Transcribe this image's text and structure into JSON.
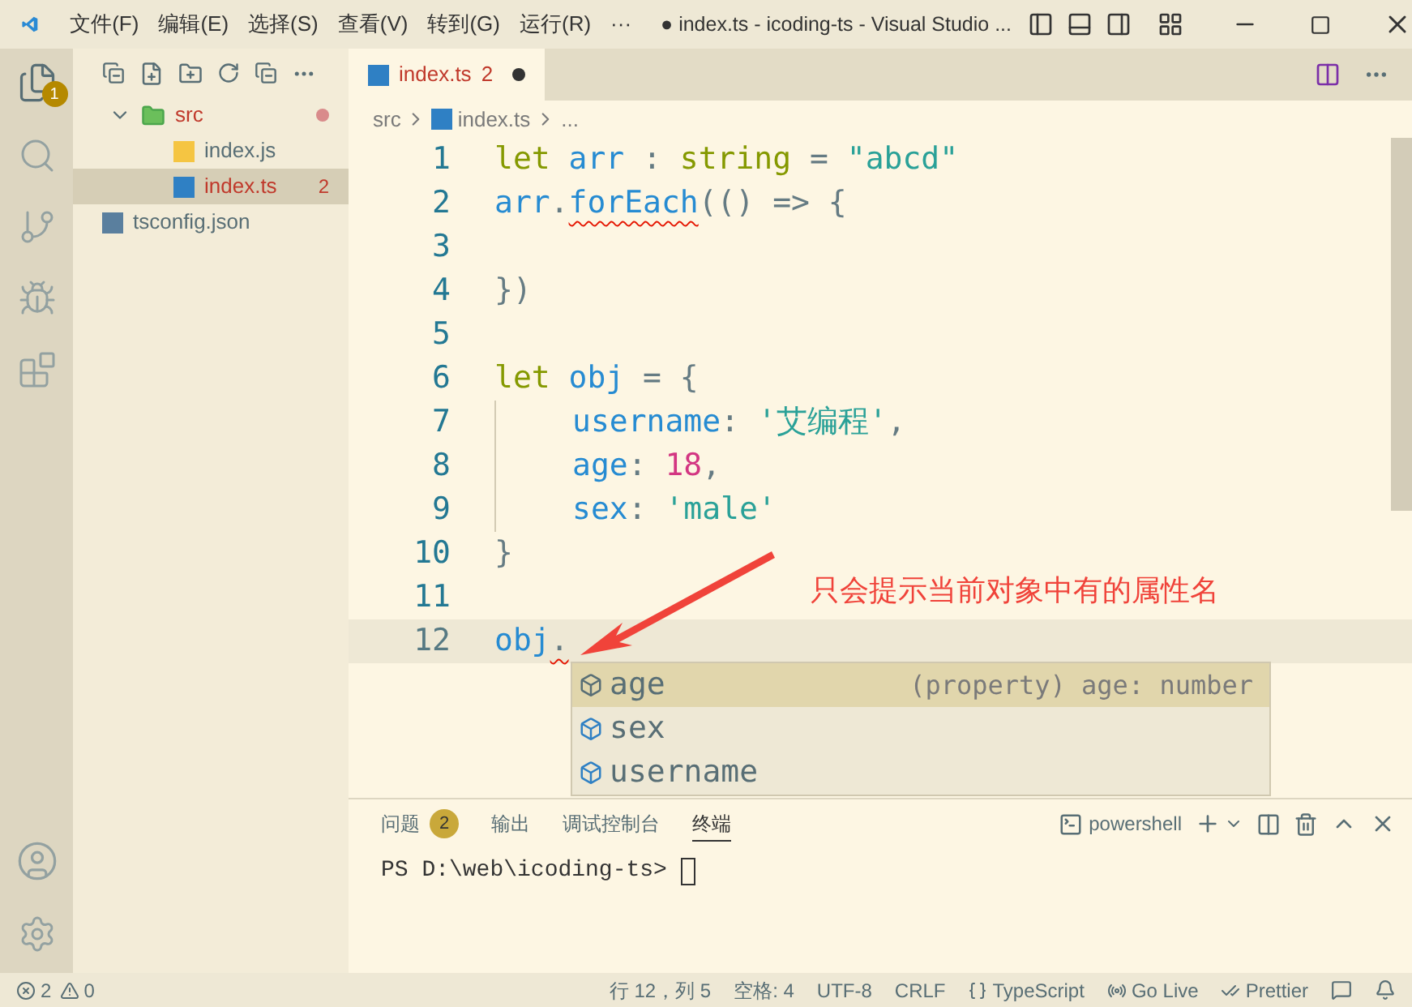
{
  "title_bar": {
    "menus": [
      "文件(F)",
      "编辑(E)",
      "选择(S)",
      "查看(V)",
      "转到(G)",
      "运行(R)",
      "···"
    ],
    "title": "● index.ts - icoding-ts - Visual Studio ..."
  },
  "activity_bar": {
    "explorer_badge": "1"
  },
  "explorer": {
    "items": [
      {
        "name": "src",
        "kind": "folder",
        "expanded": true,
        "modified": true,
        "selected": false,
        "children": [
          {
            "name": "index.js",
            "kind": "js",
            "selected": false
          },
          {
            "name": "index.ts",
            "kind": "ts",
            "selected": true,
            "errors": "2"
          }
        ]
      },
      {
        "name": "tsconfig.json",
        "kind": "tsconfig",
        "selected": false
      }
    ]
  },
  "tabs": [
    {
      "label": "index.ts",
      "errors": "2",
      "dirty": true,
      "selected": true
    }
  ],
  "breadcrumb": [
    "src",
    "index.ts",
    "..."
  ],
  "code_lines": [
    {
      "number": "1",
      "current": false,
      "tokens": [
        {
          "text": "let",
          "kind": "keyword"
        },
        {
          "text": " arr",
          "kind": "name"
        },
        {
          "text": " : ",
          "kind": "plain"
        },
        {
          "text": "string",
          "kind": "keyword"
        },
        {
          "text": " = ",
          "kind": "plain"
        },
        {
          "text": "\"abcd\"",
          "kind": "string"
        }
      ]
    },
    {
      "number": "2",
      "current": false,
      "tokens": [
        {
          "text": "arr",
          "kind": "name",
          "error": false
        },
        {
          "text": ".",
          "kind": "plain",
          "error": false
        },
        {
          "text": "forEach",
          "kind": "name",
          "error": true
        },
        {
          "text": "(() => {",
          "kind": "plain",
          "error": false
        }
      ]
    },
    {
      "number": "3",
      "current": false
    },
    {
      "number": "4",
      "current": false,
      "tokens": [
        {
          "text": "})",
          "kind": "plain"
        }
      ]
    },
    {
      "number": "5",
      "current": false
    },
    {
      "number": "6",
      "current": false,
      "tokens": [
        {
          "text": "let",
          "kind": "keyword"
        },
        {
          "text": " obj",
          "kind": "name"
        },
        {
          "text": " = {",
          "kind": "plain"
        }
      ]
    },
    {
      "number": "7",
      "current": false,
      "indent": true,
      "tokens": [
        {
          "text": "username",
          "kind": "name"
        },
        {
          "text": ": ",
          "kind": "plain"
        },
        {
          "text": "'艾编程'",
          "kind": "string"
        },
        {
          "text": ",",
          "kind": "plain"
        }
      ]
    },
    {
      "number": "8",
      "current": false,
      "indent": true,
      "tokens": [
        {
          "text": "age",
          "kind": "name"
        },
        {
          "text": ": ",
          "kind": "plain"
        },
        {
          "text": "18",
          "kind": "number"
        },
        {
          "text": ",",
          "kind": "plain"
        }
      ]
    },
    {
      "number": "9",
      "current": false,
      "indent": true,
      "tokens": [
        {
          "text": "sex",
          "kind": "name"
        },
        {
          "text": ": ",
          "kind": "plain"
        },
        {
          "text": "'male'",
          "kind": "string"
        }
      ]
    },
    {
      "number": "10",
      "current": false,
      "tokens": [
        {
          "text": "}",
          "kind": "plain"
        }
      ]
    },
    {
      "number": "11",
      "current": false
    },
    {
      "number": "12",
      "current": true,
      "tokens": [
        {
          "text": "obj",
          "kind": "name",
          "error": false
        },
        {
          "text": ".",
          "kind": "plain",
          "error": true
        }
      ]
    }
  ],
  "suggestions": [
    {
      "label": "age",
      "detail": "(property) age: number",
      "selected": true
    },
    {
      "label": "sex",
      "selected": false
    },
    {
      "label": "username",
      "selected": false
    }
  ],
  "annotation": "只会提示当前对象中有的属性名",
  "panel": {
    "tabs": [
      {
        "label": "问题",
        "badge": "2",
        "selected": false
      },
      {
        "label": "输出",
        "selected": false
      },
      {
        "label": "调试控制台",
        "selected": false
      },
      {
        "label": "终端",
        "selected": true
      }
    ],
    "shell": "powershell",
    "prompt": "PS D:\\web\\icoding-ts> "
  },
  "status_bar": {
    "errors": "2",
    "warnings": "0",
    "right": [
      "行 12，列 5",
      "空格: 4",
      "UTF-8",
      "CRLF",
      "TypeScript",
      "Go Live",
      "Prettier"
    ]
  }
}
